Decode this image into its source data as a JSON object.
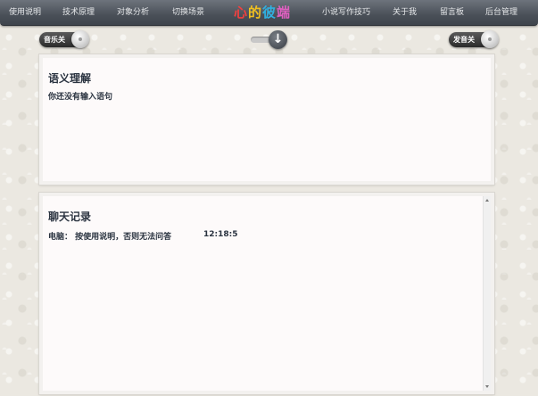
{
  "nav": {
    "items": [
      {
        "label": "使用说明"
      },
      {
        "label": "技术原理"
      },
      {
        "label": "对象分析"
      },
      {
        "label": "切换场景"
      },
      {
        "label": "小说写作技巧"
      },
      {
        "label": "关于我"
      },
      {
        "label": "留言板"
      },
      {
        "label": "后台管理"
      }
    ],
    "brand": [
      "心",
      "的",
      "彼",
      "端"
    ],
    "brand_colors": [
      "#f04040",
      "#f0c020",
      "#30b0e0",
      "#e060c0"
    ]
  },
  "controls": {
    "music_label": "音乐关",
    "voice_label": "发音关",
    "toggle_icon": "down-arrow-icon",
    "toggle_glyph": "↓"
  },
  "semantic": {
    "title": "语义理解",
    "text": "你还没有输入语句"
  },
  "chat": {
    "title": "聊天记录",
    "entry_text": "电脑： 按使用说明，否则无法问答",
    "entry_time": "12:18:5"
  }
}
